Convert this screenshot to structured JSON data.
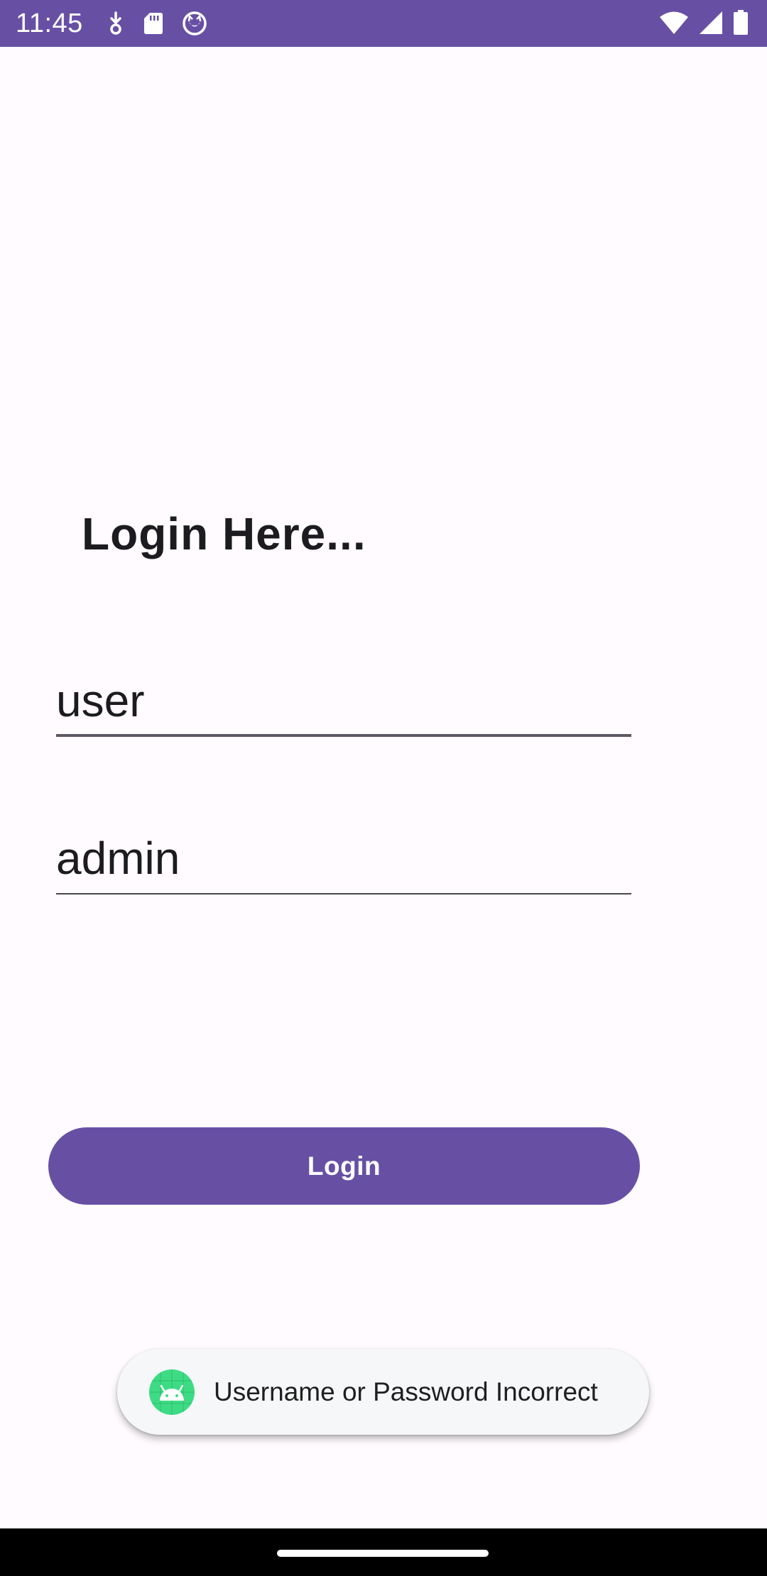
{
  "status_bar": {
    "time": "11:45",
    "left_icons": [
      "download-icon",
      "sd-card-icon",
      "cat-face-icon"
    ],
    "right_icons": [
      "wifi-icon",
      "cell-signal-icon",
      "battery-icon"
    ],
    "background_color": "#6750a4"
  },
  "screen": {
    "title": "Login Here..."
  },
  "form": {
    "username_value": "user",
    "password_value": "admin"
  },
  "login_button": {
    "label": "Login",
    "color": "#6750a4"
  },
  "toast": {
    "icon": "android-icon",
    "message": "Username or Password Incorrect"
  }
}
